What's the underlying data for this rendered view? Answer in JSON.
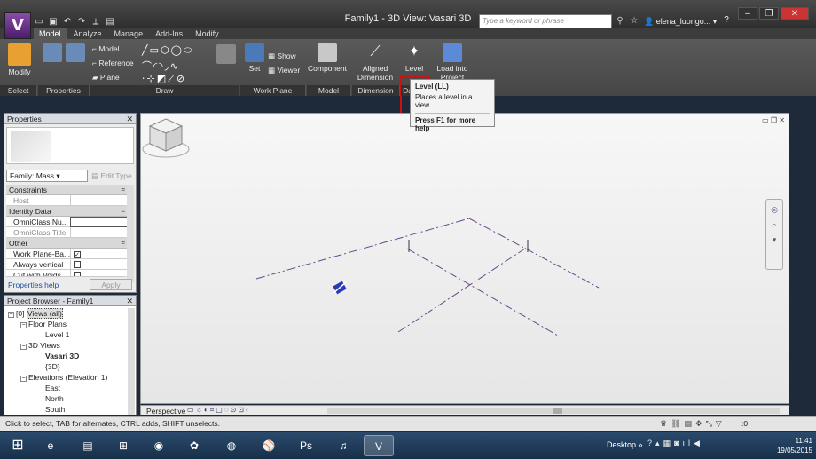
{
  "window": {
    "title": "Family1 - 3D View: Vasari 3D",
    "search_placeholder": "Type a keyword or phrase",
    "user": "elena_luongo...",
    "app_letter": "V"
  },
  "ribbon": {
    "tabs": [
      "Model",
      "Analyze",
      "Manage",
      "Add-Ins",
      "Modify"
    ],
    "active_tab": "Model",
    "buttons": {
      "modify": "Modify",
      "model": "Model",
      "reference": "Reference",
      "plane": "Plane",
      "set": "Set",
      "show": "Show",
      "viewer": "Viewer",
      "component": "Component",
      "aligned_dimension": "Aligned Dimension",
      "level": "Level",
      "load_into_project": "Load into Project"
    },
    "panels": [
      "Select",
      "Properties",
      "Draw",
      "Work Plane",
      "Model",
      "Dimension",
      "Da"
    ]
  },
  "tooltip": {
    "title": "Level (LL)",
    "description": "Places a level in a view.",
    "help": "Press F1 for more help"
  },
  "properties": {
    "title": "Properties",
    "family": "Family: Mass",
    "edit_type": "Edit Type",
    "groups": {
      "constraints": "Constraints",
      "identity": "Identity Data",
      "other": "Other"
    },
    "rows": {
      "host": "Host",
      "omniclass_number": "OmniClass Nu...",
      "omniclass_title": "OmniClass Title",
      "work_plane": "Work Plane-Ba...",
      "always_vertical": "Always vertical",
      "cut_voids": "Cut with Voids ..."
    },
    "help_link": "Properties help",
    "apply": "Apply"
  },
  "browser": {
    "title": "Project Browser - Family1",
    "items": {
      "views": "Views (all)",
      "floor_plans": "Floor Plans",
      "level1": "Level 1",
      "views3d": "3D Views",
      "vasari3d": "Vasari 3D",
      "view3d": "{3D}",
      "elevations": "Elevations (Elevation 1)",
      "east": "East",
      "north": "North",
      "south": "South"
    }
  },
  "viewbar": {
    "mode": "Perspective"
  },
  "status": {
    "text": "Click to select, TAB for alternates, CTRL adds, SHIFT unselects.",
    "filter_count": ":0"
  },
  "taskbar": {
    "desktop": "Desktop",
    "time": "11.41",
    "date": "19/05/2015"
  }
}
